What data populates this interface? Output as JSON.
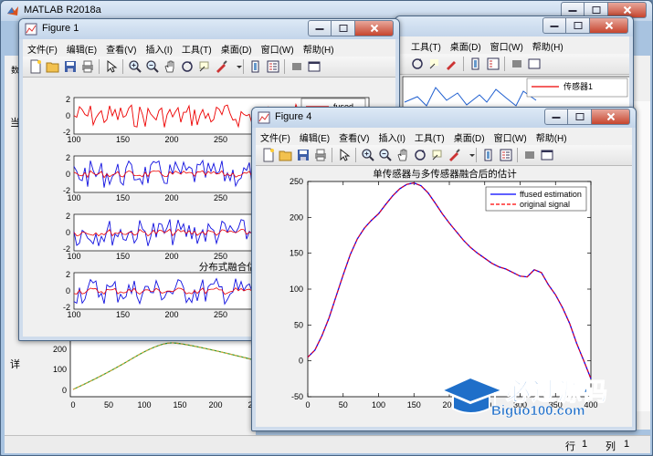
{
  "matlab": {
    "title": "MATLAB R2018a",
    "menu_fragment": "帮助(H)",
    "side_char_1": "当",
    "side_char_2": "详",
    "side_char_3": "数",
    "row_label": "行",
    "row_value": "1",
    "col_label": "列",
    "col_value": "1",
    "legend_fragment": "传感器1"
  },
  "figure1": {
    "title": "Figure 1",
    "menus": [
      "文件(F)",
      "编辑(E)",
      "查看(V)",
      "插入(I)",
      "工具(T)",
      "桌面(D)",
      "窗口(W)",
      "帮助(H)"
    ],
    "legend_text": "fused",
    "mid_title": "分布式融合估计误差",
    "yticks": [
      "2",
      "0",
      "-2"
    ],
    "xticks": [
      "100",
      "150",
      "200",
      "250"
    ]
  },
  "figure4": {
    "title": "Figure 4",
    "menus": [
      "文件(F)",
      "编辑(E)",
      "查看(V)",
      "插入(I)",
      "工具(T)",
      "桌面(D)",
      "窗口(W)",
      "帮助(H)"
    ]
  },
  "behind_figure": {
    "menus": [
      "工具(T)",
      "桌面(D)",
      "窗口(W)",
      "帮助(H)"
    ]
  },
  "bottom_plot": {
    "yticks": [
      "200",
      "100",
      "0"
    ],
    "xticks": [
      "0",
      "50",
      "100",
      "150",
      "200",
      "2"
    ]
  },
  "watermark": {
    "text": "必过源码",
    "url": "Biguo100.com"
  },
  "chart_data": {
    "type": "line",
    "title": "单传感器与多传感器融合后的估计",
    "xlabel": "",
    "ylabel": "",
    "xlim": [
      0,
      400
    ],
    "ylim": [
      -50,
      250
    ],
    "x_ticks": [
      0,
      50,
      100,
      150,
      200,
      250,
      300,
      350,
      400
    ],
    "y_ticks": [
      -50,
      0,
      50,
      100,
      150,
      200,
      250
    ],
    "legend_position": "top-right",
    "x": [
      0,
      10,
      20,
      30,
      40,
      50,
      60,
      70,
      80,
      90,
      100,
      110,
      120,
      130,
      140,
      150,
      160,
      170,
      180,
      190,
      200,
      210,
      220,
      230,
      240,
      250,
      260,
      270,
      280,
      290,
      300,
      310,
      320,
      330,
      340,
      350,
      360,
      370,
      380,
      390,
      400
    ],
    "series": [
      {
        "name": "ffused estimation",
        "color": "#0000ff",
        "values": [
          5,
          15,
          35,
          60,
          90,
          120,
          148,
          170,
          185,
          196,
          205,
          218,
          230,
          240,
          246,
          248,
          244,
          234,
          220,
          205,
          192,
          180,
          168,
          158,
          150,
          143,
          136,
          131,
          128,
          123,
          118,
          117,
          127,
          123,
          106,
          92,
          74,
          52,
          24,
          0,
          -25
        ]
      },
      {
        "name": "original signal",
        "color": "#ff0000",
        "values": [
          5,
          15,
          35,
          60,
          90,
          120,
          148,
          170,
          185,
          196,
          205,
          218,
          230,
          240,
          246,
          248,
          244,
          234,
          220,
          205,
          192,
          180,
          168,
          158,
          150,
          143,
          136,
          131,
          128,
          123,
          118,
          117,
          127,
          123,
          106,
          92,
          74,
          52,
          24,
          0,
          -25
        ]
      }
    ]
  }
}
